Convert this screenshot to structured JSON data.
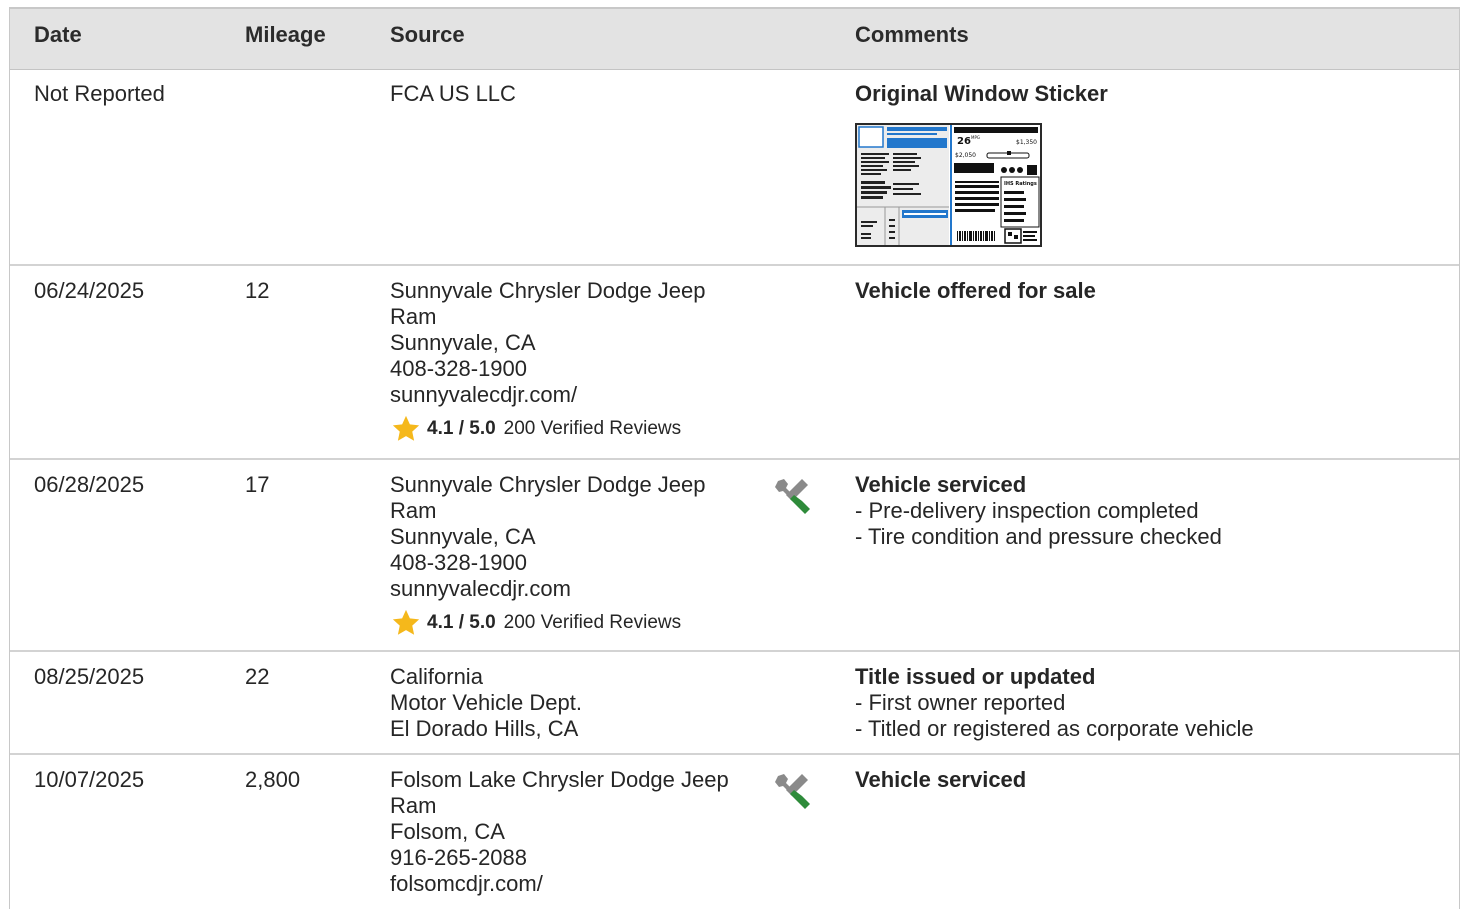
{
  "header": {
    "date": "Date",
    "mileage": "Mileage",
    "source": "Source",
    "comments": "Comments"
  },
  "rows": [
    {
      "date": "Not Reported",
      "mileage": "",
      "source_lines": [
        "FCA US LLC"
      ],
      "icon": "",
      "comment_title": "Original Window Sticker",
      "comment_bullets": [],
      "sticker": {
        "mpg": "26",
        "mpg_unit": "MPG",
        "save": "$1,350",
        "cost": "$2,050",
        "ratings": "IHS Ratings"
      }
    },
    {
      "date": "06/24/2025",
      "mileage": "12",
      "source_lines": [
        "Sunnyvale Chrysler Dodge Jeep",
        "Ram",
        "Sunnyvale, CA",
        "408-328-1900",
        "sunnyvalecdjr.com/"
      ],
      "rating": {
        "score": "4.1 / 5.0",
        "reviews": "200 Verified Reviews"
      },
      "icon": "",
      "comment_title": "Vehicle offered for sale",
      "comment_bullets": []
    },
    {
      "date": "06/28/2025",
      "mileage": "17",
      "source_lines": [
        "Sunnyvale Chrysler Dodge Jeep",
        "Ram",
        "Sunnyvale, CA",
        "408-328-1900",
        "sunnyvalecdjr.com"
      ],
      "rating": {
        "score": "4.1 / 5.0",
        "reviews": "200 Verified Reviews"
      },
      "icon": "service-tools-icon",
      "comment_title": "Vehicle serviced",
      "comment_bullets": [
        "Pre-delivery inspection completed",
        "Tire condition and pressure checked"
      ]
    },
    {
      "date": "08/25/2025",
      "mileage": "22",
      "source_lines": [
        "California",
        "Motor Vehicle Dept.",
        "El Dorado Hills, CA"
      ],
      "icon": "",
      "comment_title": "Title issued or updated",
      "comment_bullets": [
        "First owner reported",
        "Titled or registered as corporate vehicle"
      ]
    },
    {
      "date": "10/07/2025",
      "mileage": "2,800",
      "source_lines": [
        "Folsom Lake Chrysler Dodge Jeep",
        "Ram",
        "Folsom, CA",
        "916-265-2088",
        "folsomcdjr.com/"
      ],
      "icon": "service-tools-icon",
      "comment_title": "Vehicle serviced",
      "comment_bullets": []
    }
  ],
  "colors": {
    "header_bg": "#e3e3e3",
    "star": "#f5b81b",
    "wrench_green": "#2e8b3a",
    "tool_gray": "#8a8a8a"
  }
}
